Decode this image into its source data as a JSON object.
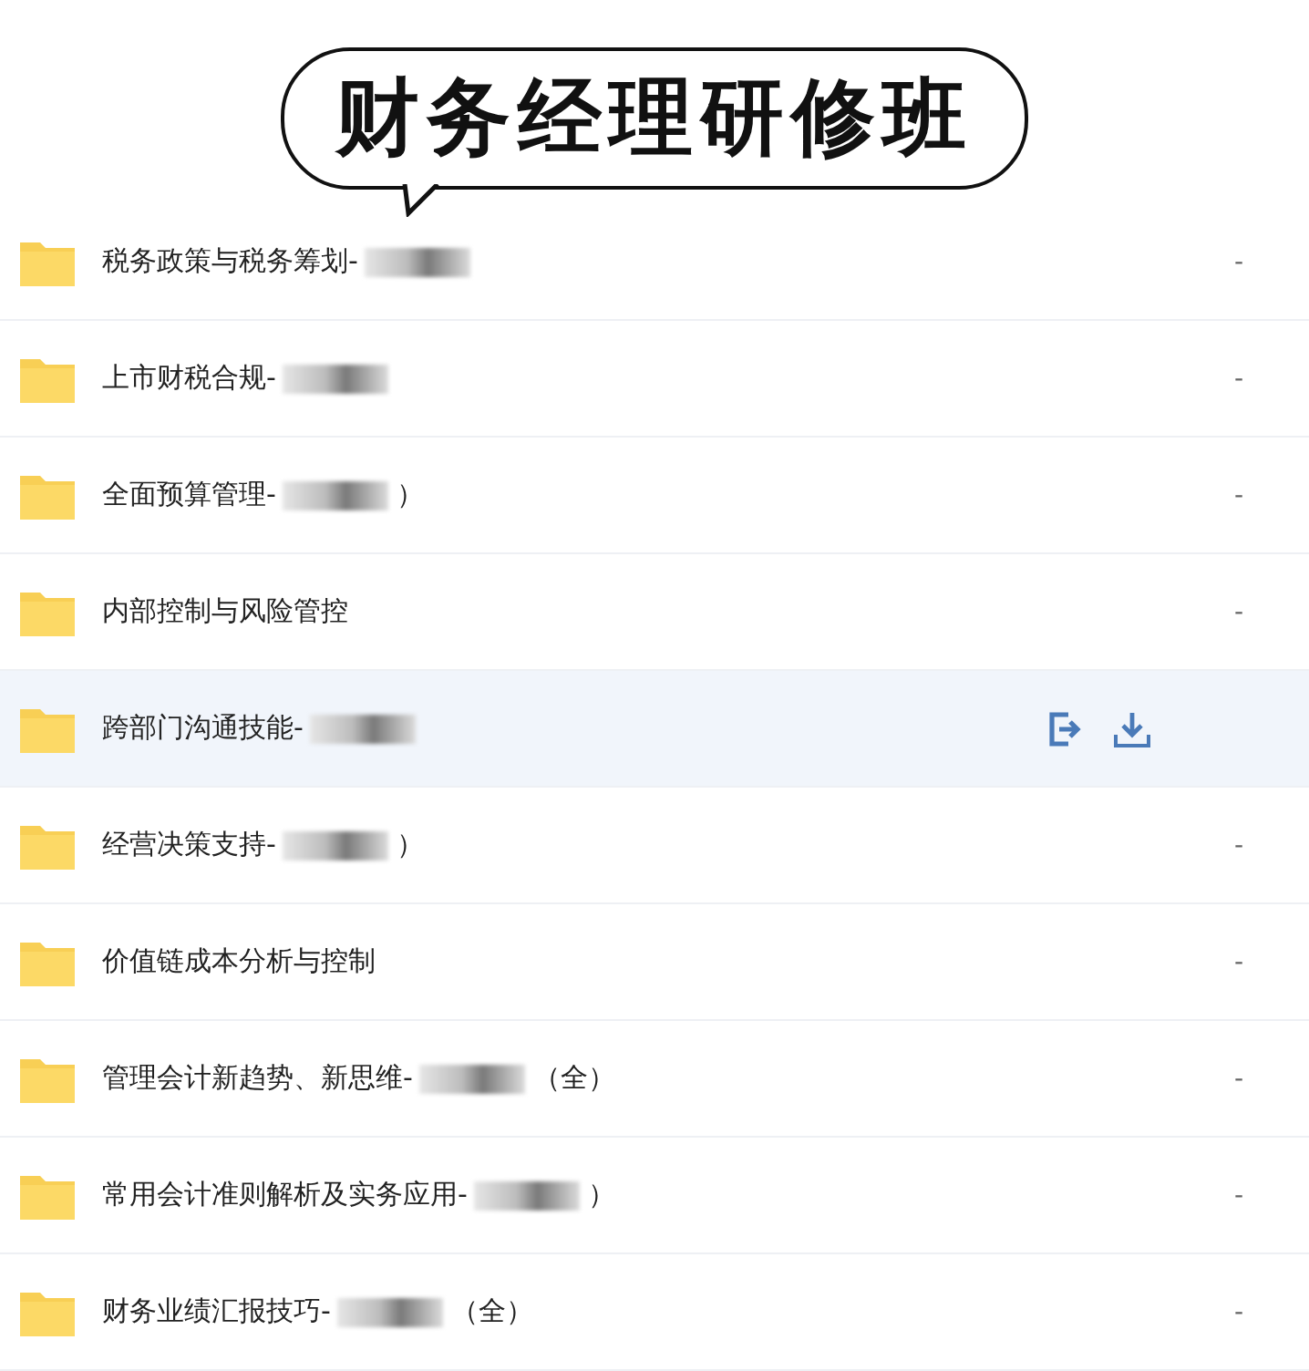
{
  "title": "财务经理研修班",
  "rows": [
    {
      "name": "税务政策与税务筹划-",
      "redacted": true,
      "suffix": "",
      "size": "-",
      "selected": false
    },
    {
      "name": "上市财税合规-",
      "redacted": true,
      "suffix": "",
      "size": "-",
      "selected": false
    },
    {
      "name": "全面预算管理-",
      "redacted": true,
      "suffix": "）",
      "size": "-",
      "selected": false
    },
    {
      "name": "内部控制与风险管控",
      "redacted": false,
      "suffix": "",
      "size": "-",
      "selected": false
    },
    {
      "name": "跨部门沟通技能-",
      "redacted": true,
      "suffix": "",
      "selected": true
    },
    {
      "name": "经营决策支持-",
      "redacted": true,
      "suffix": "）",
      "size": "-",
      "selected": false
    },
    {
      "name": "价值链成本分析与控制",
      "redacted": false,
      "suffix": "",
      "size": "-",
      "selected": false
    },
    {
      "name": "管理会计新趋势、新思维-",
      "redacted": true,
      "suffix": "（全）",
      "size": "-",
      "selected": false
    },
    {
      "name": "常用会计准则解析及实务应用-",
      "redacted": true,
      "suffix": "）",
      "size": "-",
      "selected": false
    },
    {
      "name": "财务业绩汇报技巧-",
      "redacted": true,
      "suffix": "（全）",
      "size": "-",
      "selected": false
    }
  ]
}
